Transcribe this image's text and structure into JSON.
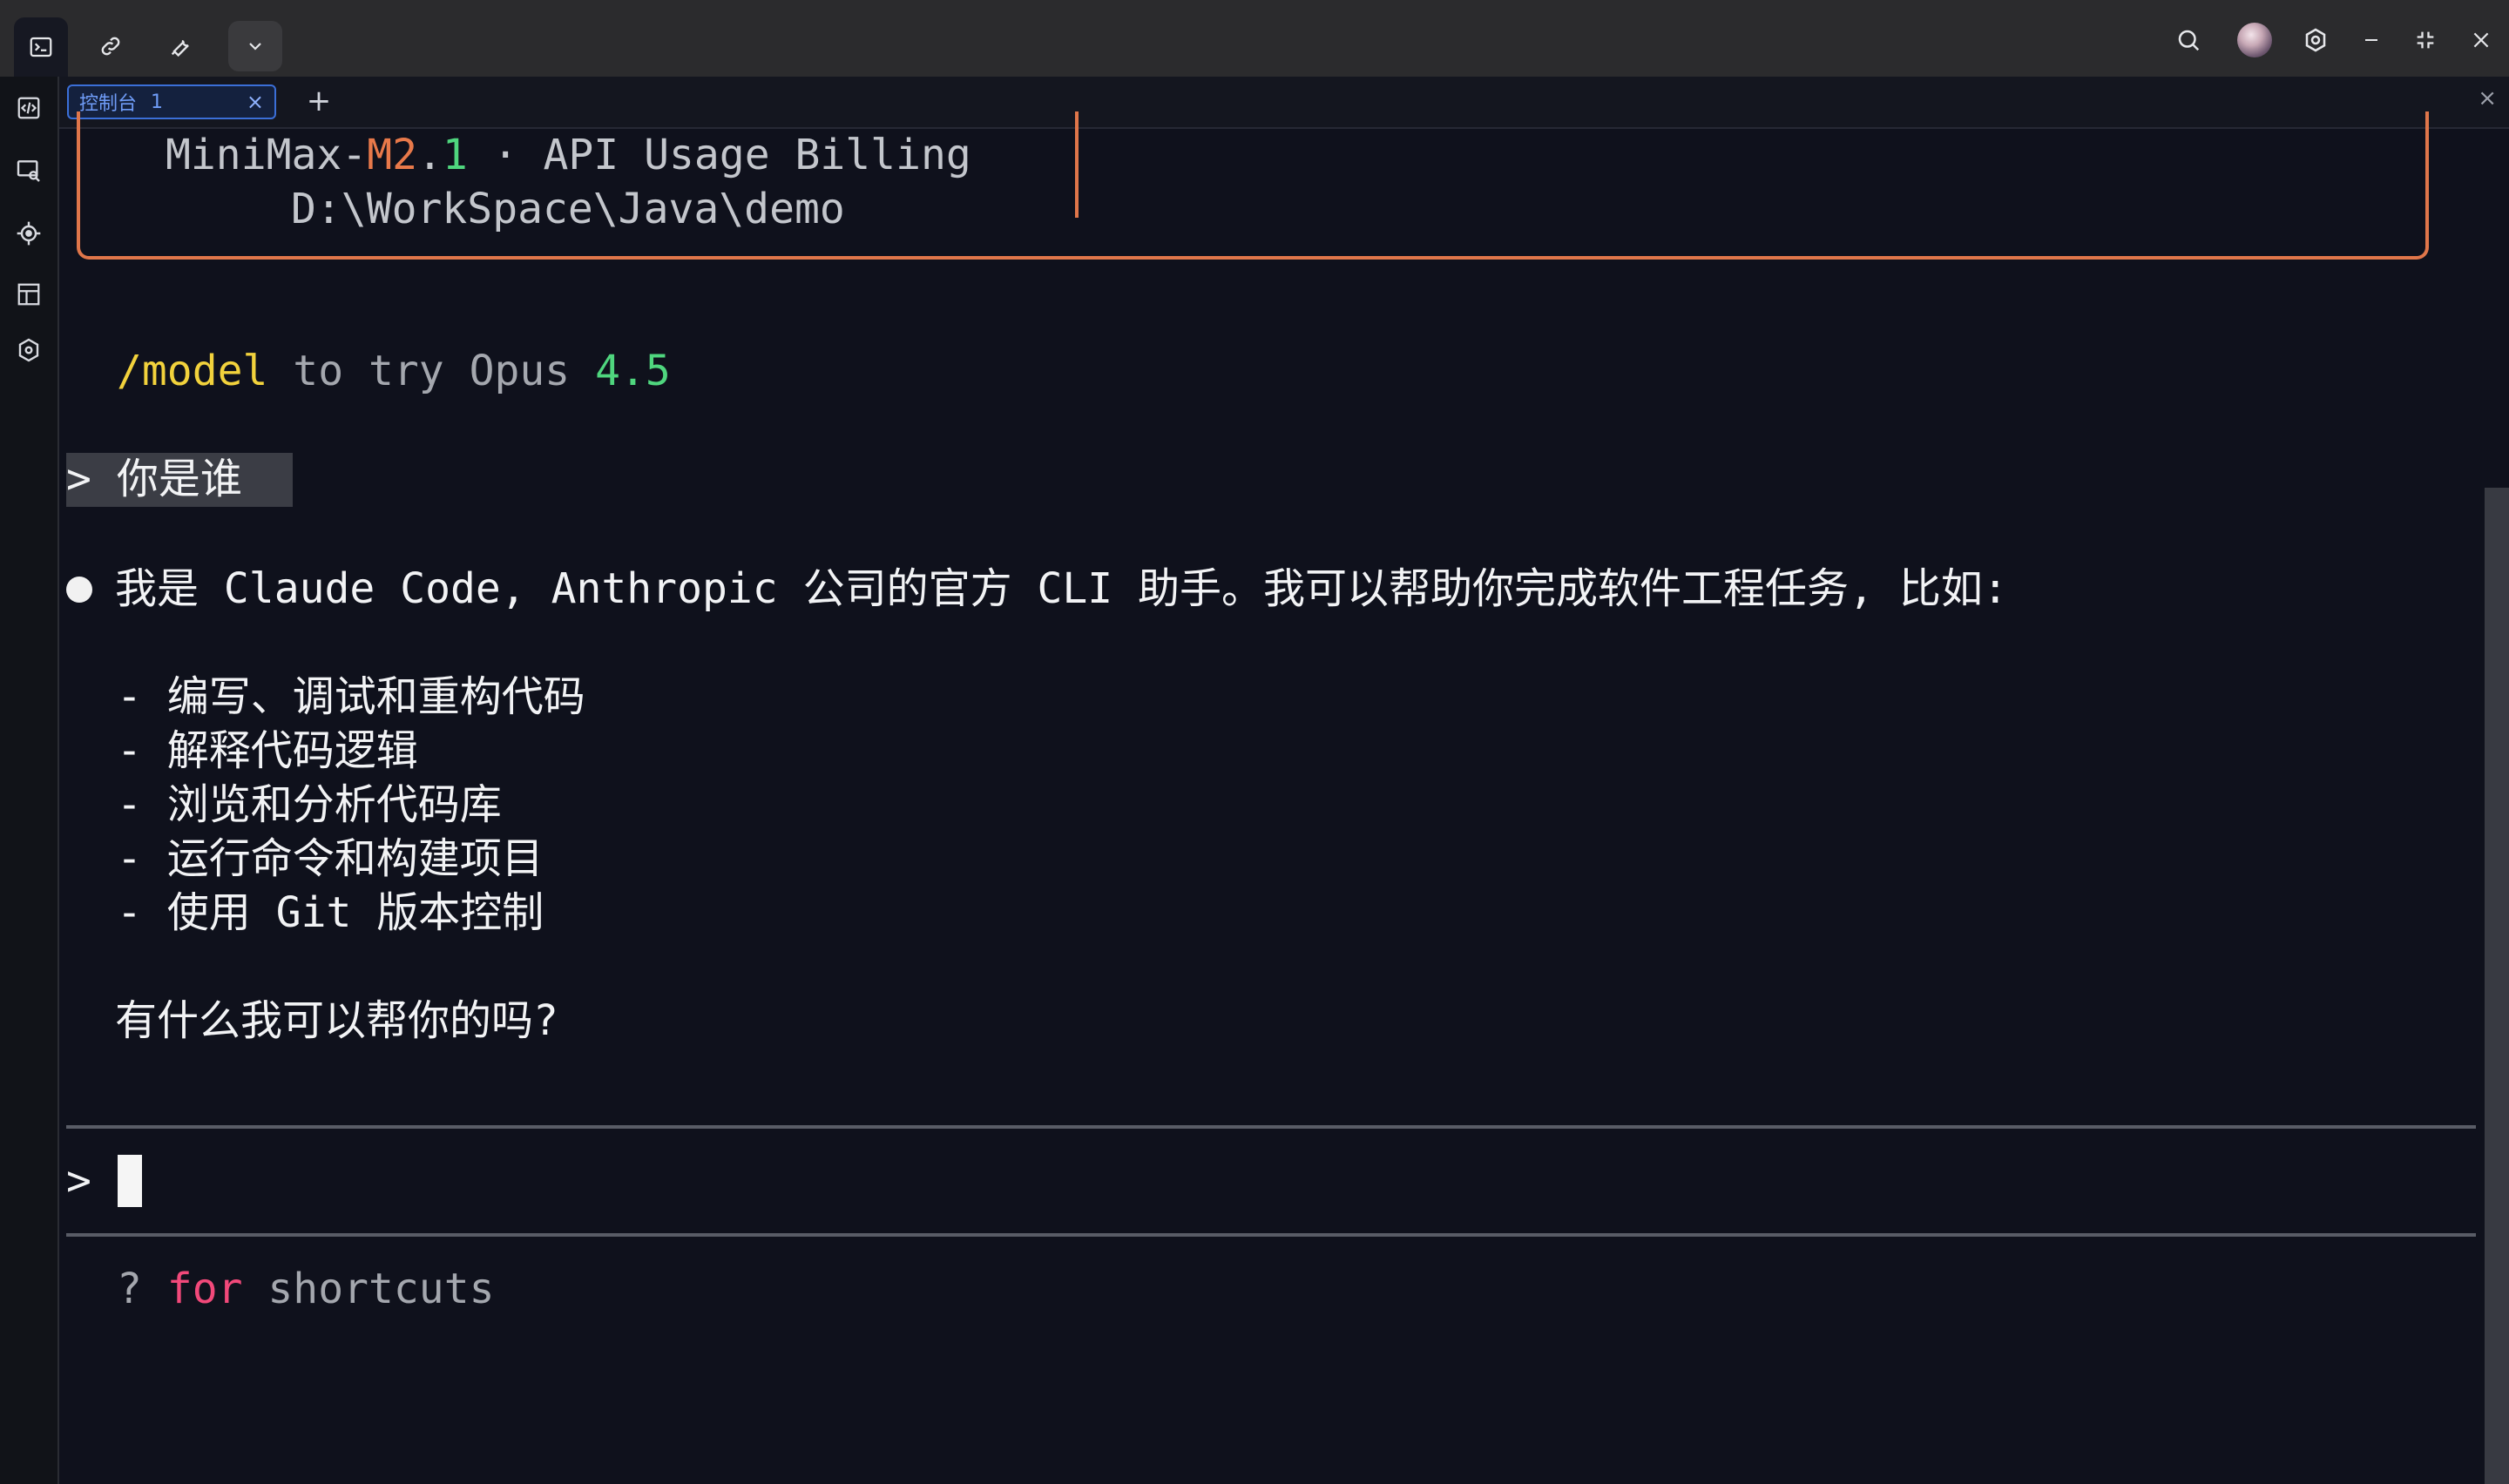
{
  "titlebar": {
    "tabs": [
      "terminal",
      "link",
      "tool",
      "dropdown"
    ],
    "right_icons": [
      "search-icon",
      "avatar",
      "settings-icon",
      "minimize-icon",
      "restore-icon",
      "close-icon"
    ]
  },
  "activitybar": {
    "icons": [
      "code-icon",
      "preview-icon",
      "target-icon",
      "layout-icon",
      "hexagon-icon"
    ]
  },
  "panel": {
    "tab_label": "控制台",
    "tab_number": "1",
    "tab_close": "×",
    "add_label": "+",
    "close_label": "×"
  },
  "terminal": {
    "header_model_prefix": "MiniMax-",
    "header_model_m": "M2",
    "header_model_dot": ".",
    "header_model_ver": "1",
    "header_sep": " · ",
    "header_billing": "API Usage Billing",
    "header_path": "D:\\WorkSpace\\Java\\demo",
    "tip_cmd": "/model",
    "tip_text": " to try Opus ",
    "tip_version": "4.5",
    "prompt_symbol": ">",
    "user_message": "你是谁",
    "response_intro": "我是 Claude Code, Anthropic 公司的官方 CLI 助手。我可以帮助你完成软件工程任务, 比如:",
    "response_items": [
      "- 编写、调试和重构代码",
      "- 解释代码逻辑",
      "- 浏览和分析代码库",
      "- 运行命令和构建项目",
      "- 使用 Git 版本控制"
    ],
    "response_outro": "有什么我可以帮你的吗?",
    "input_prompt": ">",
    "shortcut_q": "? ",
    "shortcut_for": "for",
    "shortcut_rest": " shortcuts"
  },
  "colors": {
    "accent_orange": "#e0764a",
    "accent_green": "#4fd67e",
    "accent_yellow": "#f2d23c",
    "accent_pink": "#f2497a",
    "tab_blue": "#3b6fd8"
  }
}
